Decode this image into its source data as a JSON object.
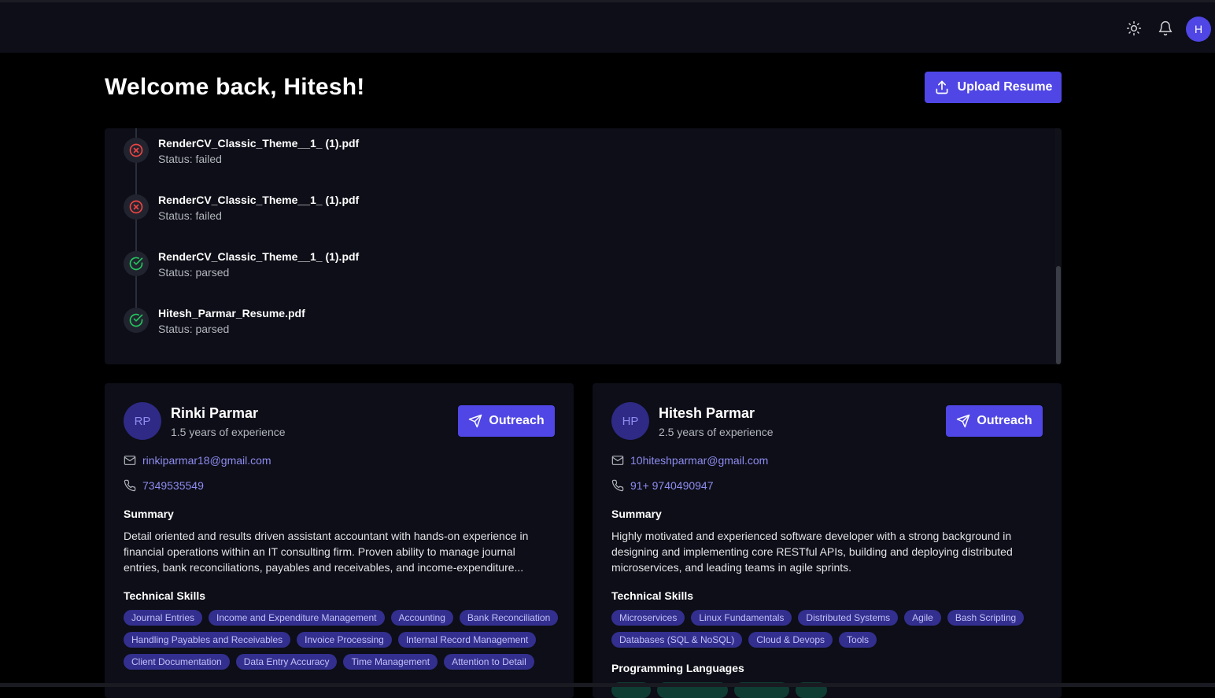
{
  "header": {
    "avatar_initial": "H",
    "icons": [
      "sun-icon",
      "bell-icon"
    ]
  },
  "welcome": "Welcome back, Hitesh!",
  "upload_label": "Upload Resume",
  "history": [
    {
      "name": "RenderCV_Classic_Theme__1_ (1).pdf",
      "status": "Status: failed",
      "state": "failed"
    },
    {
      "name": "RenderCV_Classic_Theme__1_ (1).pdf",
      "status": "Status: failed",
      "state": "failed"
    },
    {
      "name": "RenderCV_Classic_Theme__1_ (1).pdf",
      "status": "Status: parsed",
      "state": "parsed"
    },
    {
      "name": "Hitesh_Parmar_Resume.pdf",
      "status": "Status: parsed",
      "state": "parsed"
    }
  ],
  "colors": {
    "accent": "#4f46e5",
    "failed": "#ef4444",
    "parsed": "#22c55e",
    "chip_bg": "#332f8f"
  },
  "candidates": [
    {
      "initials": "RP",
      "name": "Rinki Parmar",
      "experience": "1.5 years of experience",
      "outreach_label": "Outreach",
      "email": "rinkiparmar18@gmail.com",
      "phone": "7349535549",
      "summary_title": "Summary",
      "summary": "Detail oriented and results driven assistant accountant with hands-on experience in financial operations within an IT consulting firm. Proven ability to manage journal entries, bank reconciliations, payables and receivables, and income-expenditure...",
      "skills_title": "Technical Skills",
      "skills": [
        "Journal Entries",
        "Income and Expenditure Management",
        "Accounting",
        "Bank Reconciliation",
        "Handling Payables and Receivables",
        "Invoice Processing",
        "Internal Record Management",
        "Client Documentation",
        "Data Entry Accuracy",
        "Time Management",
        "Attention to Detail"
      ]
    },
    {
      "initials": "HP",
      "name": "Hitesh Parmar",
      "experience": "2.5 years of experience",
      "outreach_label": "Outreach",
      "email": "10hiteshparmar@gmail.com",
      "phone": "91+ 9740490947",
      "summary_title": "Summary",
      "summary": "Highly motivated and experienced software developer with a strong background in designing and implementing core RESTful APIs, building and deploying distributed microservices, and leading teams in agile sprints.",
      "skills_title": "Technical Skills",
      "skills": [
        "Microservices",
        "Linux Fundamentals",
        "Distributed Systems",
        "Agile",
        "Bash Scripting",
        "Databases (SQL & NoSQL)",
        "Cloud & Devops",
        "Tools"
      ],
      "languages_title": "Programming Languages"
    }
  ]
}
